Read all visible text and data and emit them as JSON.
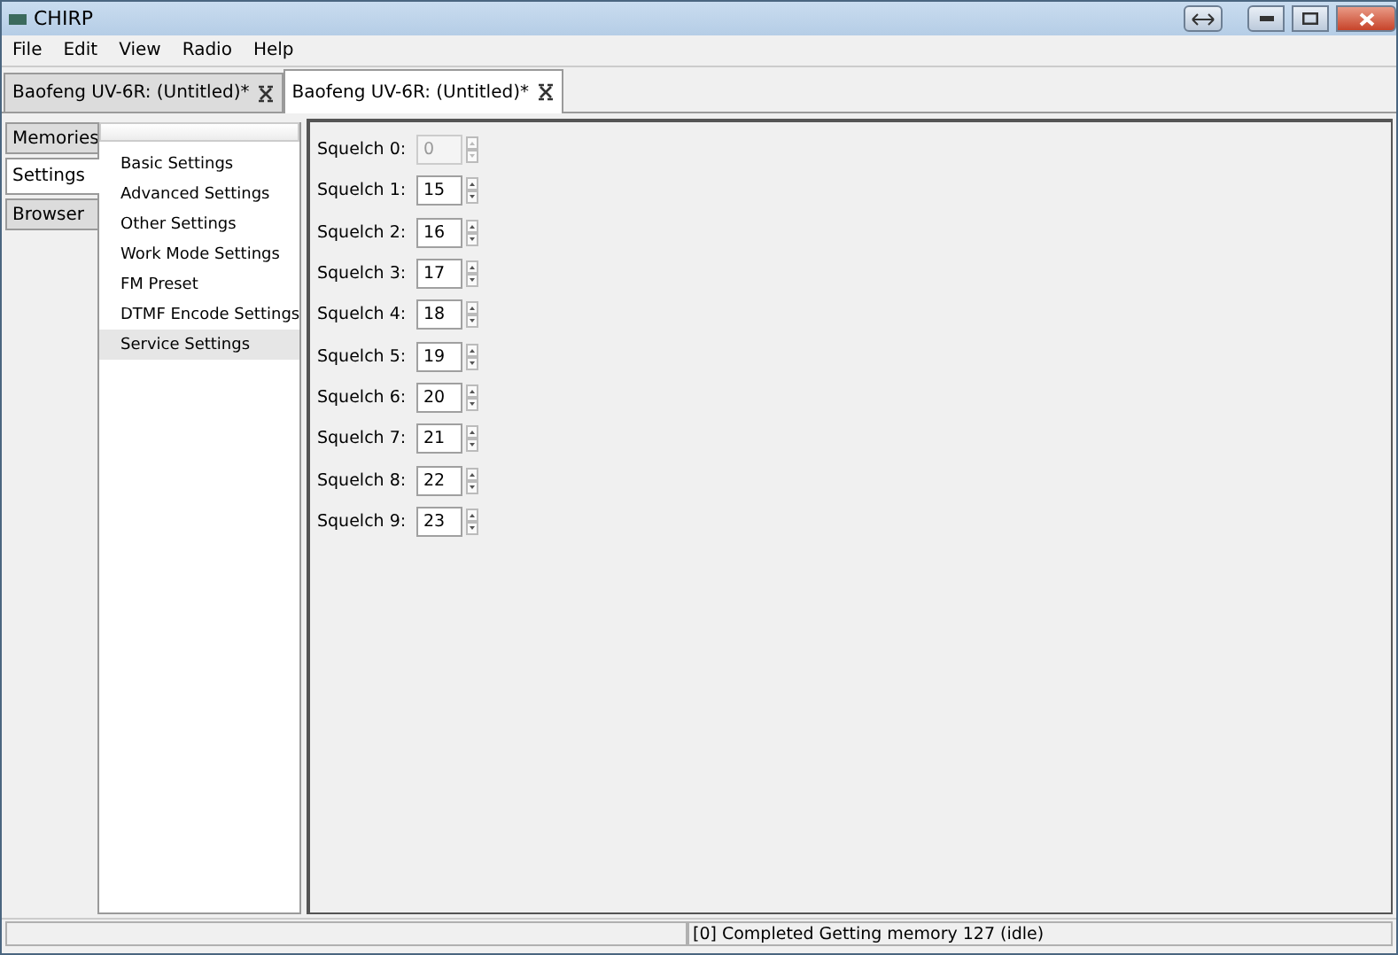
{
  "window": {
    "title": "CHIRP"
  },
  "menu": [
    "File",
    "Edit",
    "View",
    "Radio",
    "Help"
  ],
  "tabs": [
    {
      "label": "Baofeng UV-6R: (Untitled)*",
      "selected": false
    },
    {
      "label": "Baofeng UV-6R: (Untitled)*",
      "selected": true
    }
  ],
  "side_tabs": [
    {
      "label": "Memories",
      "selected": false
    },
    {
      "label": "Settings",
      "selected": true
    },
    {
      "label": "Browser",
      "selected": false
    }
  ],
  "settings_tree": [
    {
      "label": "Basic Settings",
      "selected": false
    },
    {
      "label": "Advanced Settings",
      "selected": false
    },
    {
      "label": "Other Settings",
      "selected": false
    },
    {
      "label": "Work Mode Settings",
      "selected": false
    },
    {
      "label": "FM Preset",
      "selected": false
    },
    {
      "label": "DTMF Encode Settings",
      "selected": false
    },
    {
      "label": "Service Settings",
      "selected": true
    }
  ],
  "fields": [
    {
      "label": "Squelch 0:",
      "value": "0",
      "disabled": true
    },
    {
      "label": "Squelch 1:",
      "value": "15",
      "disabled": false
    },
    {
      "label": "Squelch 2:",
      "value": "16",
      "disabled": false
    },
    {
      "label": "Squelch 3:",
      "value": "17",
      "disabled": false
    },
    {
      "label": "Squelch 4:",
      "value": "18",
      "disabled": false
    },
    {
      "label": "Squelch 5:",
      "value": "19",
      "disabled": false
    },
    {
      "label": "Squelch 6:",
      "value": "20",
      "disabled": false
    },
    {
      "label": "Squelch 7:",
      "value": "21",
      "disabled": false
    },
    {
      "label": "Squelch 8:",
      "value": "22",
      "disabled": false
    },
    {
      "label": "Squelch 9:",
      "value": "23",
      "disabled": false
    }
  ],
  "status_bar": "[0] Completed Getting memory 127 (idle)"
}
